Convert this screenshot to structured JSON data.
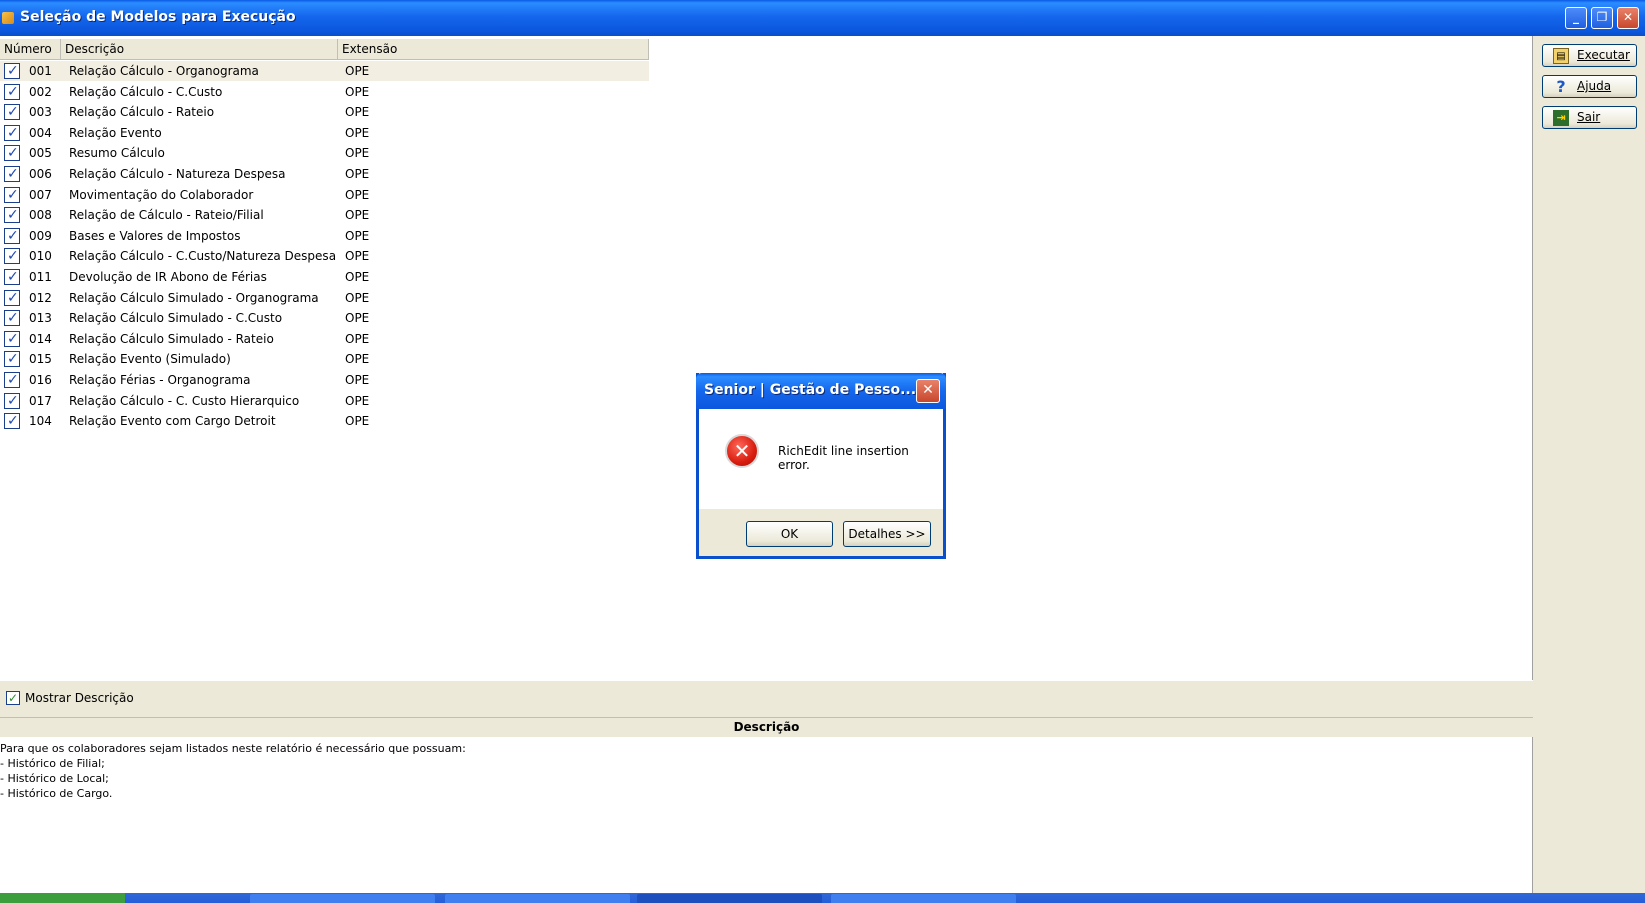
{
  "window": {
    "title": "Seleção de Modelos para Execução",
    "controls": {
      "minimize": "_",
      "restore": "❐",
      "close": "✕"
    }
  },
  "table": {
    "headers": {
      "number": "Número",
      "description": "Descrição",
      "extension": "Extensão"
    },
    "rows": [
      {
        "num": "001",
        "desc": "Relação Cálculo - Organograma",
        "ext": "OPE"
      },
      {
        "num": "002",
        "desc": "Relação Cálculo - C.Custo",
        "ext": "OPE"
      },
      {
        "num": "003",
        "desc": "Relação Cálculo - Rateio",
        "ext": "OPE"
      },
      {
        "num": "004",
        "desc": "Relação Evento",
        "ext": "OPE"
      },
      {
        "num": "005",
        "desc": "Resumo Cálculo",
        "ext": "OPE"
      },
      {
        "num": "006",
        "desc": "Relação Cálculo - Natureza Despesa",
        "ext": "OPE"
      },
      {
        "num": "007",
        "desc": "Movimentação do Colaborador",
        "ext": "OPE"
      },
      {
        "num": "008",
        "desc": "Relação de Cálculo - Rateio/Filial",
        "ext": "OPE"
      },
      {
        "num": "009",
        "desc": "Bases e Valores de Impostos",
        "ext": "OPE"
      },
      {
        "num": "010",
        "desc": "Relação Cálculo - C.Custo/Natureza Despesa",
        "ext": "OPE"
      },
      {
        "num": "011",
        "desc": "Devolução de IR Abono de Férias",
        "ext": "OPE"
      },
      {
        "num": "012",
        "desc": "Relação Cálculo Simulado - Organograma",
        "ext": "OPE"
      },
      {
        "num": "013",
        "desc": "Relação Cálculo Simulado - C.Custo",
        "ext": "OPE"
      },
      {
        "num": "014",
        "desc": "Relação Cálculo Simulado - Rateio",
        "ext": "OPE"
      },
      {
        "num": "015",
        "desc": "Relação Evento (Simulado)",
        "ext": "OPE"
      },
      {
        "num": "016",
        "desc": "Relação Férias - Organograma",
        "ext": "OPE"
      },
      {
        "num": "017",
        "desc": "Relação Cálculo - C. Custo Hierarquico",
        "ext": "OPE"
      },
      {
        "num": "104",
        "desc": "Relação Evento com Cargo Detroit",
        "ext": "OPE"
      }
    ]
  },
  "show_description": {
    "label": "Mostrar Descrição",
    "checked": true
  },
  "description_panel": {
    "header": "Descrição",
    "lines": [
      "Para que os colaboradores sejam listados neste relatório é necessário que possuam:",
      "- Histórico de Filial;",
      "- Histórico de Local;",
      "- Histórico de Cargo."
    ]
  },
  "toolbar": {
    "execute_label": "Executar",
    "help_label": "Ajuda",
    "exit_label": "Sair"
  },
  "dialog": {
    "title": "Senior | Gestão de Pesso...",
    "message": "RichEdit line insertion error.",
    "ok_label": "OK",
    "details_label": "Detalhes >>"
  }
}
